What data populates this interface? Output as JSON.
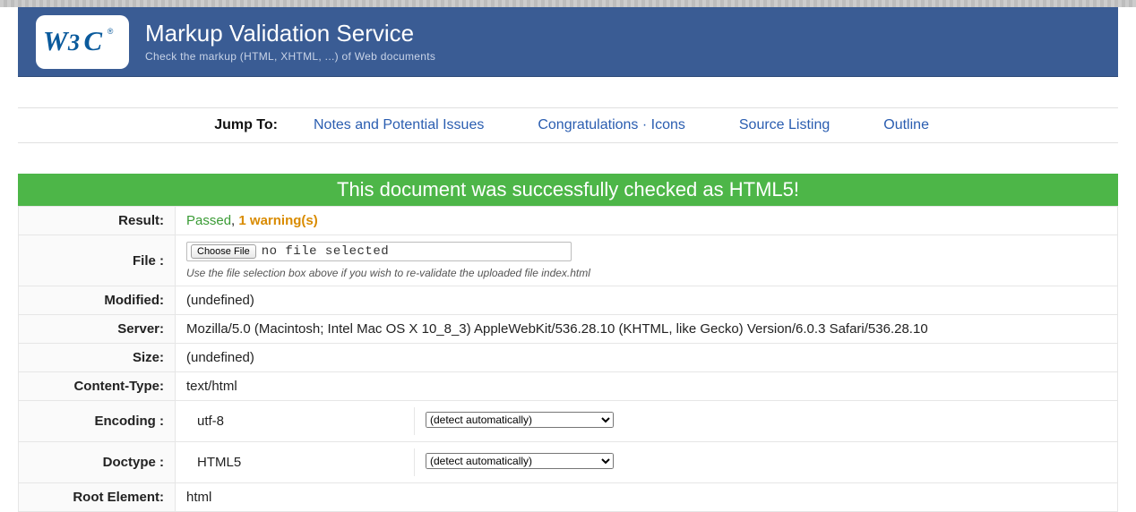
{
  "header": {
    "title": "Markup Validation Service",
    "subtitle": "Check the markup (HTML, XHTML, ...) of Web documents",
    "logo_text": "W3C",
    "logo_reg": "®"
  },
  "jumpbar": {
    "label": "Jump To:",
    "links": {
      "notes": "Notes and Potential Issues",
      "congrats": "Congratulations · Icons",
      "source": "Source Listing",
      "outline": "Outline"
    }
  },
  "success_banner": "This document was successfully checked as HTML5!",
  "rows": {
    "result": {
      "label": "Result:",
      "passed": "Passed",
      "comma": ", ",
      "warn": "1 warning(s)"
    },
    "file": {
      "label": "File :",
      "choose_label": "Choose File",
      "no_file": "no file selected",
      "hint": "Use the file selection box above if you wish to re-validate the uploaded file index.html"
    },
    "modified": {
      "label": "Modified:",
      "value": "(undefined)"
    },
    "server": {
      "label": "Server:",
      "value": "Mozilla/5.0 (Macintosh; Intel Mac OS X 10_8_3) AppleWebKit/536.28.10 (KHTML, like Gecko) Version/6.0.3 Safari/536.28.10"
    },
    "size": {
      "label": "Size:",
      "value": "(undefined)"
    },
    "content_type": {
      "label": "Content-Type:",
      "value": "text/html"
    },
    "encoding": {
      "label": "Encoding :",
      "value": "utf-8",
      "select": "(detect automatically)"
    },
    "doctype": {
      "label": "Doctype :",
      "value": "HTML5",
      "select": "(detect automatically)"
    },
    "root": {
      "label": "Root Element:",
      "value": "html"
    }
  }
}
